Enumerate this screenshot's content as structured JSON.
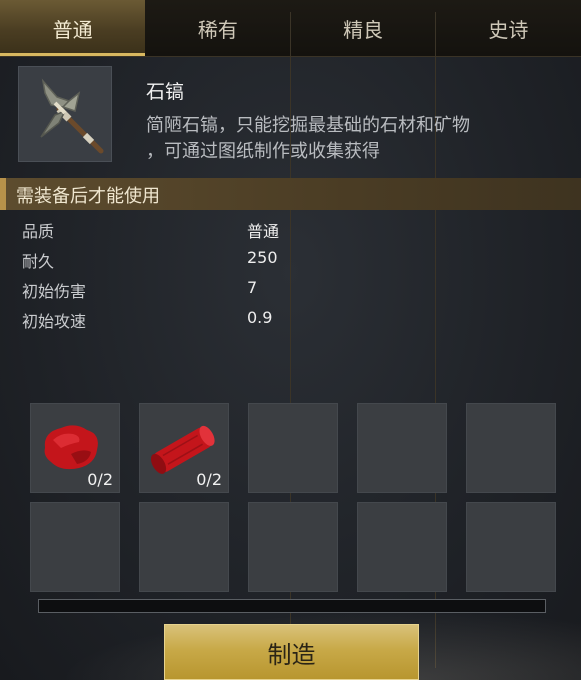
{
  "tabs": [
    {
      "label": "普通",
      "active": true
    },
    {
      "label": "稀有",
      "active": false
    },
    {
      "label": "精良",
      "active": false
    },
    {
      "label": "史诗",
      "active": false
    }
  ],
  "item": {
    "name": "石镐",
    "description_line1": "简陋石镐，只能挖掘最基础的石材和矿物",
    "description_line2": "，可通过图纸制作或收集获得",
    "icon": "stone-pickaxe-icon"
  },
  "requirement": "需装备后才能使用",
  "stats": [
    {
      "label": "品质",
      "value": "普通"
    },
    {
      "label": "耐久",
      "value": "250"
    },
    {
      "label": "初始伤害",
      "value": "7"
    },
    {
      "label": "初始攻速",
      "value": "0.9"
    }
  ],
  "materials": [
    {
      "icon": "red-ore-chunk-icon",
      "count": "0/2"
    },
    {
      "icon": "red-log-icon",
      "count": "0/2"
    },
    {
      "icon": "",
      "count": ""
    },
    {
      "icon": "",
      "count": ""
    },
    {
      "icon": "",
      "count": ""
    },
    {
      "icon": "",
      "count": ""
    },
    {
      "icon": "",
      "count": ""
    },
    {
      "icon": "",
      "count": ""
    },
    {
      "icon": "",
      "count": ""
    },
    {
      "icon": "",
      "count": ""
    }
  ],
  "progress": 0,
  "craft_button": "制造",
  "colors": {
    "accent_gold": "#d8b860",
    "material_red": "#c4151b"
  }
}
